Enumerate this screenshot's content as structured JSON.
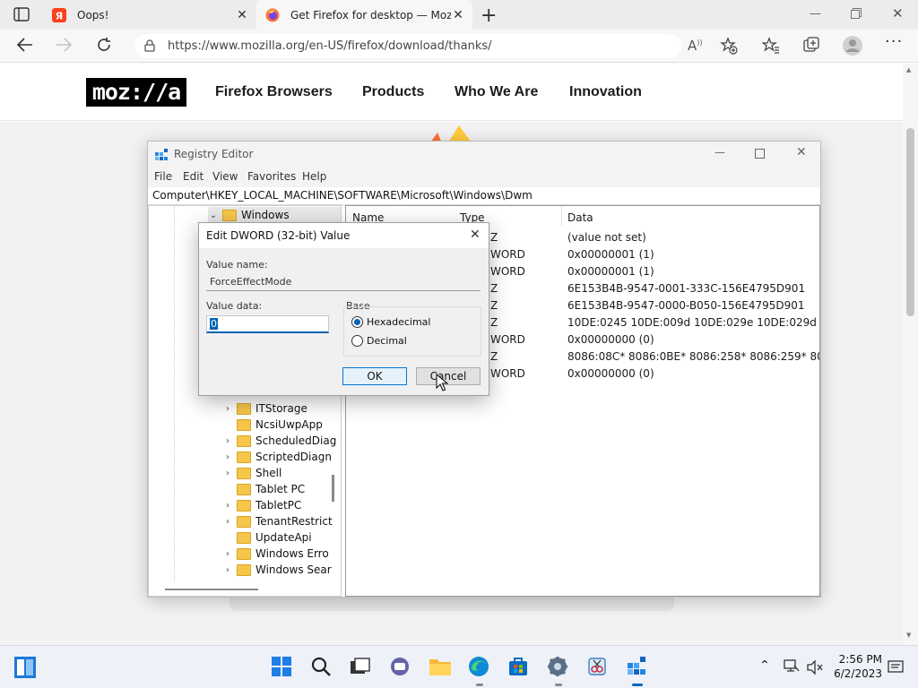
{
  "browser": {
    "tabs": [
      {
        "title": "Oops!",
        "active": false
      },
      {
        "title": "Get Firefox for desktop — Mozilla",
        "active": true
      }
    ],
    "url": "https://www.mozilla.org/en-US/firefox/download/thanks/"
  },
  "page": {
    "logo": "moz://a",
    "nav": [
      "Firefox Browsers",
      "Products",
      "Who We Are",
      "Innovation"
    ]
  },
  "regedit": {
    "title": "Registry Editor",
    "menu": [
      "File",
      "Edit",
      "View",
      "Favorites",
      "Help"
    ],
    "address": "Computer\\HKEY_LOCAL_MACHINE\\SOFTWARE\\Microsoft\\Windows\\Dwm",
    "tree_top": {
      "label": "Windows"
    },
    "tree": [
      {
        "label": "ITStorage",
        "expandable": true
      },
      {
        "label": "NcsiUwpApp",
        "expandable": false
      },
      {
        "label": "ScheduledDiag",
        "expandable": true
      },
      {
        "label": "ScriptedDiagn",
        "expandable": true
      },
      {
        "label": "Shell",
        "expandable": true
      },
      {
        "label": "Tablet PC",
        "expandable": false
      },
      {
        "label": "TabletPC",
        "expandable": true
      },
      {
        "label": "TenantRestrict",
        "expandable": true
      },
      {
        "label": "UpdateApi",
        "expandable": false
      },
      {
        "label": "Windows Erro",
        "expandable": true
      },
      {
        "label": "Windows Sear",
        "expandable": true
      }
    ],
    "columns": {
      "name": "Name",
      "type": "Type",
      "data": "Data"
    },
    "rows": [
      {
        "type": "Z",
        "data": "(value not set)"
      },
      {
        "type": "WORD",
        "data": "0x00000001 (1)"
      },
      {
        "type": "WORD",
        "data": "0x00000001 (1)"
      },
      {
        "type": "Z",
        "data": "6E153B4B-9547-0001-333C-156E4795D901"
      },
      {
        "type": "Z",
        "data": "6E153B4B-9547-0000-B050-156E4795D901"
      },
      {
        "type": "Z",
        "data": "10DE:0245 10DE:009d 10DE:029e 10DE:029d 10DE:02..."
      },
      {
        "type": "WORD",
        "data": "0x00000000 (0)"
      },
      {
        "type": "Z",
        "data": "8086:08C* 8086:0BE* 8086:258* 8086:259* 8086:277*..."
      },
      {
        "type": "WORD",
        "data": "0x00000000 (0)"
      }
    ]
  },
  "dialog": {
    "title": "Edit DWORD (32-bit) Value",
    "value_name_label": "Value name:",
    "value_name": "ForceEffectMode",
    "value_data_label": "Value data:",
    "value_data": "0",
    "base_label": "Base",
    "radio_hex": "Hexadecimal",
    "radio_dec": "Decimal",
    "selected_base": "Hexadecimal",
    "ok": "OK",
    "cancel": "Cancel"
  },
  "taskbar": {
    "time": "2:56 PM",
    "date": "6/2/2023"
  }
}
